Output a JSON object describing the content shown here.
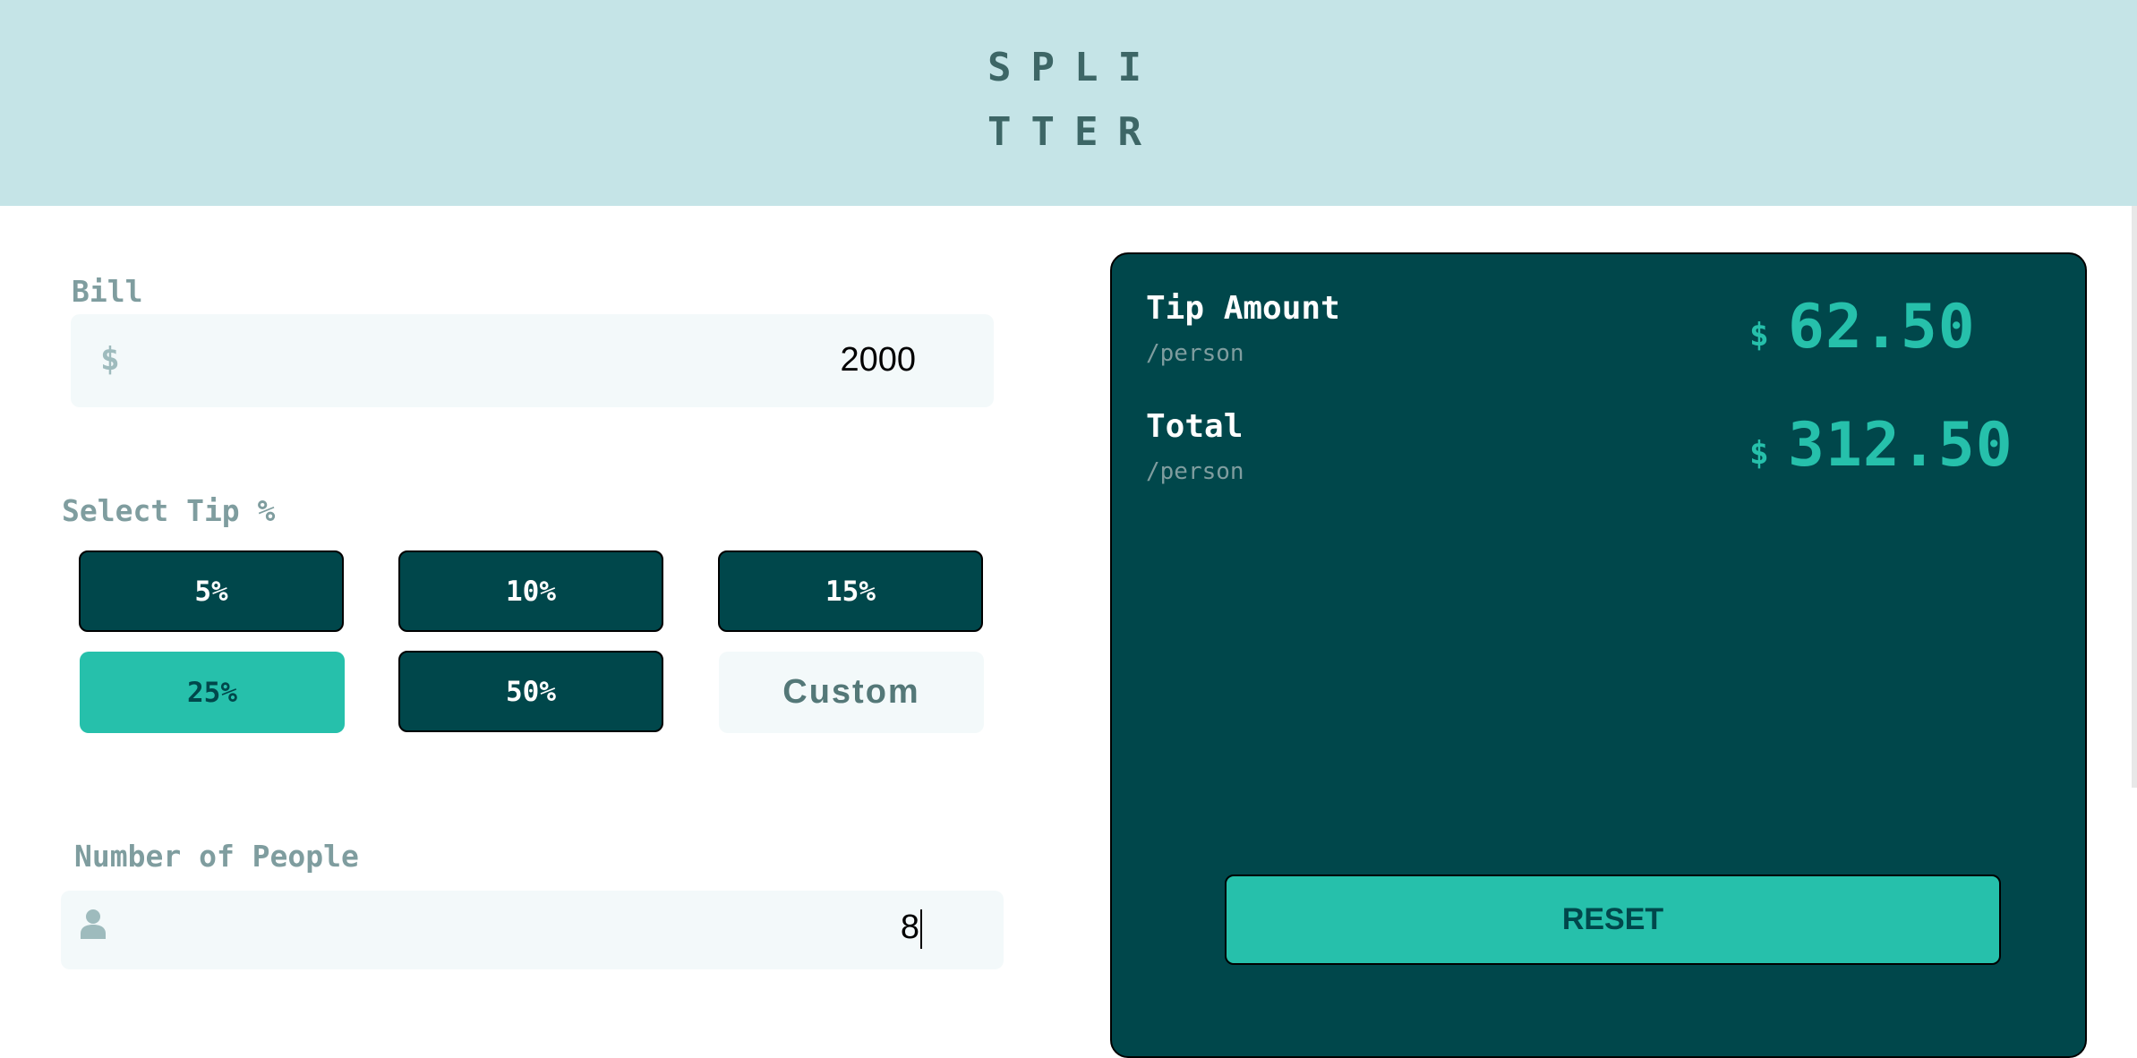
{
  "header": {
    "logo_line1": "SPLI",
    "logo_line2": "TTER"
  },
  "bill": {
    "label": "Bill",
    "currency_symbol": "$",
    "value": "2000"
  },
  "tip": {
    "label": "Select Tip %",
    "options": [
      {
        "label": "5%",
        "selected": false
      },
      {
        "label": "10%",
        "selected": false
      },
      {
        "label": "15%",
        "selected": false
      },
      {
        "label": "25%",
        "selected": true
      },
      {
        "label": "50%",
        "selected": false
      }
    ],
    "custom_label": "Custom"
  },
  "people": {
    "label": "Number of People",
    "icon": "person-icon",
    "value": "8"
  },
  "results": {
    "tip_amount": {
      "title": "Tip Amount",
      "sub": "/person",
      "currency": "$",
      "value": "62.50"
    },
    "total": {
      "title": "Total",
      "sub": "/person",
      "currency": "$",
      "value": "312.50"
    },
    "reset_label": "RESET"
  },
  "colors": {
    "header_bg": "#c5e4e7",
    "dark_teal": "#00474b",
    "accent": "#26c0ab",
    "input_bg": "#f3f9fa",
    "label_grey": "#7f9d9f"
  }
}
